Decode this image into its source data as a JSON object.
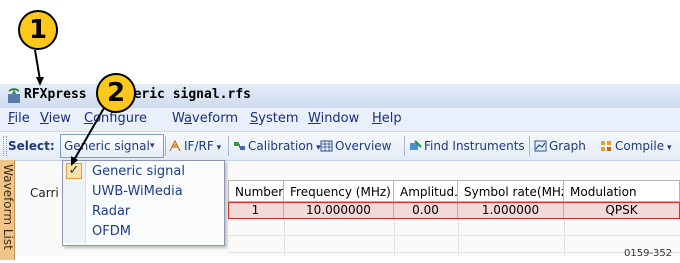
{
  "window": {
    "title": "RFXpress - Generic signal.rfs"
  },
  "menu": {
    "items": [
      "File",
      "View",
      "Configure",
      "Waveform",
      "System",
      "Window",
      "Help"
    ],
    "underline": [
      "F",
      "V",
      "C",
      "a",
      "S",
      "W",
      "H"
    ]
  },
  "toolbar": {
    "select_label": "Select:",
    "select_value": "Generic signal",
    "if_rf": "IF/RF",
    "calibration": "Calibration",
    "overview": "Overview",
    "find_instruments": "Find Instruments",
    "graph": "Graph",
    "compile": "Compile"
  },
  "side_tab": {
    "label": "Waveform List"
  },
  "panel": {
    "carrier_label": "Carri"
  },
  "table": {
    "headers": [
      "Number",
      "Frequency (MHz)",
      "Amplitud..",
      "Symbol rate(MHz)",
      "Modulation"
    ],
    "rows": [
      [
        "1",
        "10.000000",
        "0.00",
        "1.000000",
        "QPSK"
      ]
    ]
  },
  "dropdown": {
    "items": [
      "Generic signal",
      "UWB-WiMedia",
      "Radar",
      "OFDM"
    ],
    "checked_index": 0,
    "check_mark": "✓"
  },
  "callouts": [
    "1",
    "2"
  ],
  "figure_code": "0159-352",
  "colors": {
    "callout": "#ffc81a",
    "selected_row": "#f5d8d8",
    "accent": "#1f3b78"
  }
}
